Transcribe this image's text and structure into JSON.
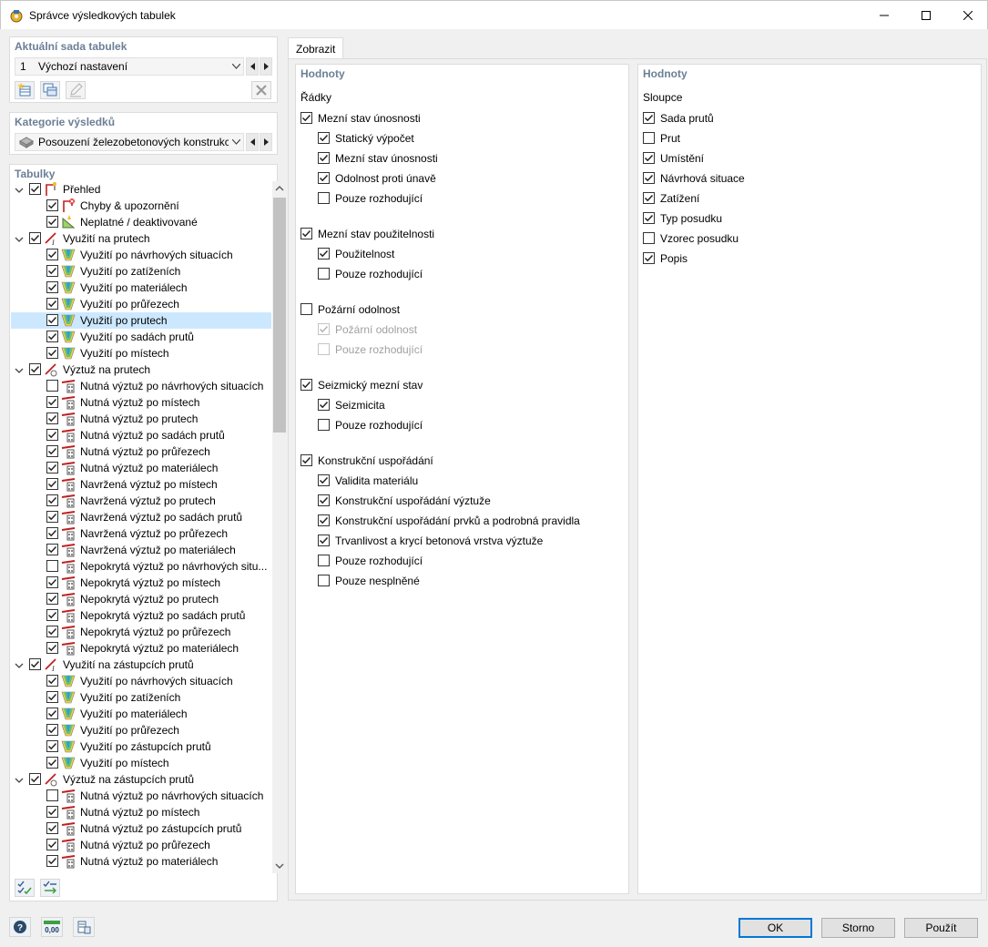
{
  "window": {
    "title": "Správce výsledkových tabulek"
  },
  "current_set": {
    "title": "Aktuální sada tabulek",
    "number": "1",
    "name": "Výchozí nastavení"
  },
  "category": {
    "title": "Kategorie výsledků",
    "value": "Posouzení železobetonových konstrukcí"
  },
  "tables": {
    "title": "Tabulky",
    "items": [
      {
        "level": 0,
        "label": "Přehled",
        "checked": true,
        "expander": true,
        "icon": "overview-icon"
      },
      {
        "level": 1,
        "label": "Chyby & upozornění",
        "checked": true,
        "icon": "errors-warnings-icon"
      },
      {
        "level": 1,
        "label": "Neplatné / deaktivované",
        "checked": true,
        "icon": "invalid-deactivated-icon"
      },
      {
        "level": 0,
        "label": "Využití na prutech",
        "checked": true,
        "expander": true,
        "icon": "member-ratio-icon"
      },
      {
        "level": 1,
        "label": "Využití po návrhových situacích",
        "checked": true,
        "icon": "ratio-icon"
      },
      {
        "level": 1,
        "label": "Využití po zatíženích",
        "checked": true,
        "icon": "ratio-icon"
      },
      {
        "level": 1,
        "label": "Využití po materiálech",
        "checked": true,
        "icon": "ratio-icon"
      },
      {
        "level": 1,
        "label": "Využití po průřezech",
        "checked": true,
        "icon": "ratio-icon"
      },
      {
        "level": 1,
        "label": "Využití po prutech",
        "checked": true,
        "icon": "ratio-icon",
        "selected": true
      },
      {
        "level": 1,
        "label": "Využití po sadách prutů",
        "checked": true,
        "icon": "ratio-icon"
      },
      {
        "level": 1,
        "label": "Využití po místech",
        "checked": true,
        "icon": "ratio-icon"
      },
      {
        "level": 0,
        "label": "Výztuž na prutech",
        "checked": true,
        "expander": true,
        "icon": "member-reinforcement-icon"
      },
      {
        "level": 1,
        "label": "Nutná výztuž po návrhových situacích",
        "checked": false,
        "icon": "reinforcement-icon"
      },
      {
        "level": 1,
        "label": "Nutná výztuž po místech",
        "checked": true,
        "icon": "reinforcement-icon"
      },
      {
        "level": 1,
        "label": "Nutná výztuž po prutech",
        "checked": true,
        "icon": "reinforcement-icon"
      },
      {
        "level": 1,
        "label": "Nutná výztuž po sadách prutů",
        "checked": true,
        "icon": "reinforcement-icon"
      },
      {
        "level": 1,
        "label": "Nutná výztuž po průřezech",
        "checked": true,
        "icon": "reinforcement-icon"
      },
      {
        "level": 1,
        "label": "Nutná výztuž po materiálech",
        "checked": true,
        "icon": "reinforcement-icon"
      },
      {
        "level": 1,
        "label": "Navržená výztuž po místech",
        "checked": true,
        "icon": "reinforcement-icon"
      },
      {
        "level": 1,
        "label": "Navržená výztuž po prutech",
        "checked": true,
        "icon": "reinforcement-icon"
      },
      {
        "level": 1,
        "label": "Navržená výztuž po sadách prutů",
        "checked": true,
        "icon": "reinforcement-icon"
      },
      {
        "level": 1,
        "label": "Navržená výztuž po průřezech",
        "checked": true,
        "icon": "reinforcement-icon"
      },
      {
        "level": 1,
        "label": "Navržená výztuž po materiálech",
        "checked": true,
        "icon": "reinforcement-icon"
      },
      {
        "level": 1,
        "label": "Nepokrytá výztuž po návrhových situ...",
        "checked": false,
        "icon": "reinforcement-icon"
      },
      {
        "level": 1,
        "label": "Nepokrytá výztuž po místech",
        "checked": true,
        "icon": "reinforcement-icon"
      },
      {
        "level": 1,
        "label": "Nepokrytá výztuž po prutech",
        "checked": true,
        "icon": "reinforcement-icon"
      },
      {
        "level": 1,
        "label": "Nepokrytá výztuž po sadách prutů",
        "checked": true,
        "icon": "reinforcement-icon"
      },
      {
        "level": 1,
        "label": "Nepokrytá výztuž po průřezech",
        "checked": true,
        "icon": "reinforcement-icon"
      },
      {
        "level": 1,
        "label": "Nepokrytá výztuž po materiálech",
        "checked": true,
        "icon": "reinforcement-icon"
      },
      {
        "level": 0,
        "label": "Využití na zástupcích prutů",
        "checked": true,
        "expander": true,
        "icon": "representative-ratio-icon"
      },
      {
        "level": 1,
        "label": "Využití po návrhových situacích",
        "checked": true,
        "icon": "ratio-icon"
      },
      {
        "level": 1,
        "label": "Využití po zatíženích",
        "checked": true,
        "icon": "ratio-icon"
      },
      {
        "level": 1,
        "label": "Využití po materiálech",
        "checked": true,
        "icon": "ratio-icon"
      },
      {
        "level": 1,
        "label": "Využití po průřezech",
        "checked": true,
        "icon": "ratio-icon"
      },
      {
        "level": 1,
        "label": "Využití po zástupcích prutů",
        "checked": true,
        "icon": "ratio-icon"
      },
      {
        "level": 1,
        "label": "Využití po místech",
        "checked": true,
        "icon": "ratio-icon"
      },
      {
        "level": 0,
        "label": "Výztuž na zástupcích prutů",
        "checked": true,
        "expander": true,
        "icon": "representative-reinforcement-icon"
      },
      {
        "level": 1,
        "label": "Nutná výztuž po návrhových situacích",
        "checked": false,
        "icon": "reinforcement-icon"
      },
      {
        "level": 1,
        "label": "Nutná výztuž po místech",
        "checked": true,
        "icon": "reinforcement-icon"
      },
      {
        "level": 1,
        "label": "Nutná výztuž po zástupcích prutů",
        "checked": true,
        "icon": "reinforcement-icon"
      },
      {
        "level": 1,
        "label": "Nutná výztuž po průřezech",
        "checked": true,
        "icon": "reinforcement-icon"
      },
      {
        "level": 1,
        "label": "Nutná výztuž po materiálech",
        "checked": true,
        "icon": "reinforcement-icon"
      }
    ]
  },
  "tab": {
    "label": "Zobrazit"
  },
  "values_rows": {
    "title": "Hodnoty",
    "subtitle": "Řádky",
    "groups": [
      {
        "label": "Mezní stav únosnosti",
        "checked": true,
        "children": [
          {
            "label": "Statický výpočet",
            "checked": true
          },
          {
            "label": "Mezní stav únosnosti",
            "checked": true
          },
          {
            "label": "Odolnost proti únavě",
            "checked": true
          },
          {
            "label": "Pouze rozhodující",
            "checked": false
          }
        ]
      },
      {
        "label": "Mezní stav použitelnosti",
        "checked": true,
        "children": [
          {
            "label": "Použitelnost",
            "checked": true
          },
          {
            "label": "Pouze rozhodující",
            "checked": false
          }
        ]
      },
      {
        "label": "Požární odolnost",
        "checked": false,
        "children": [
          {
            "label": "Požární odolnost",
            "checked": true,
            "disabled": true
          },
          {
            "label": "Pouze rozhodující",
            "checked": false,
            "disabled": true
          }
        ]
      },
      {
        "label": "Seizmický mezní stav",
        "checked": true,
        "children": [
          {
            "label": "Seizmicita",
            "checked": true
          },
          {
            "label": "Pouze rozhodující",
            "checked": false
          }
        ]
      },
      {
        "label": "Konstrukční uspořádání",
        "checked": true,
        "children": [
          {
            "label": "Validita materiálu",
            "checked": true
          },
          {
            "label": "Konstrukční uspořádání výztuže",
            "checked": true
          },
          {
            "label": "Konstrukční uspořádání prvků a podrobná pravidla",
            "checked": true
          },
          {
            "label": "Trvanlivost a krycí betonová vrstva výztuže",
            "checked": true
          },
          {
            "label": "Pouze rozhodující",
            "checked": false
          },
          {
            "label": "Pouze nesplněné",
            "checked": false
          }
        ]
      }
    ]
  },
  "values_columns": {
    "title": "Hodnoty",
    "subtitle": "Sloupce",
    "items": [
      {
        "label": "Sada prutů",
        "checked": true
      },
      {
        "label": "Prut",
        "checked": false
      },
      {
        "label": "Umístění",
        "checked": true
      },
      {
        "label": "Návrhová situace",
        "checked": true
      },
      {
        "label": "Zatížení",
        "checked": true
      },
      {
        "label": "Typ posudku",
        "checked": true
      },
      {
        "label": "Vzorec posudku",
        "checked": false
      },
      {
        "label": "Popis",
        "checked": true
      }
    ]
  },
  "buttons": {
    "ok": "OK",
    "cancel": "Storno",
    "apply": "Použít"
  },
  "bottom_icons": {
    "units_label": "0,00"
  },
  "colors": {
    "accent": "#0078d7",
    "section_title": "#6b7f96",
    "selection": "#cce8ff"
  }
}
